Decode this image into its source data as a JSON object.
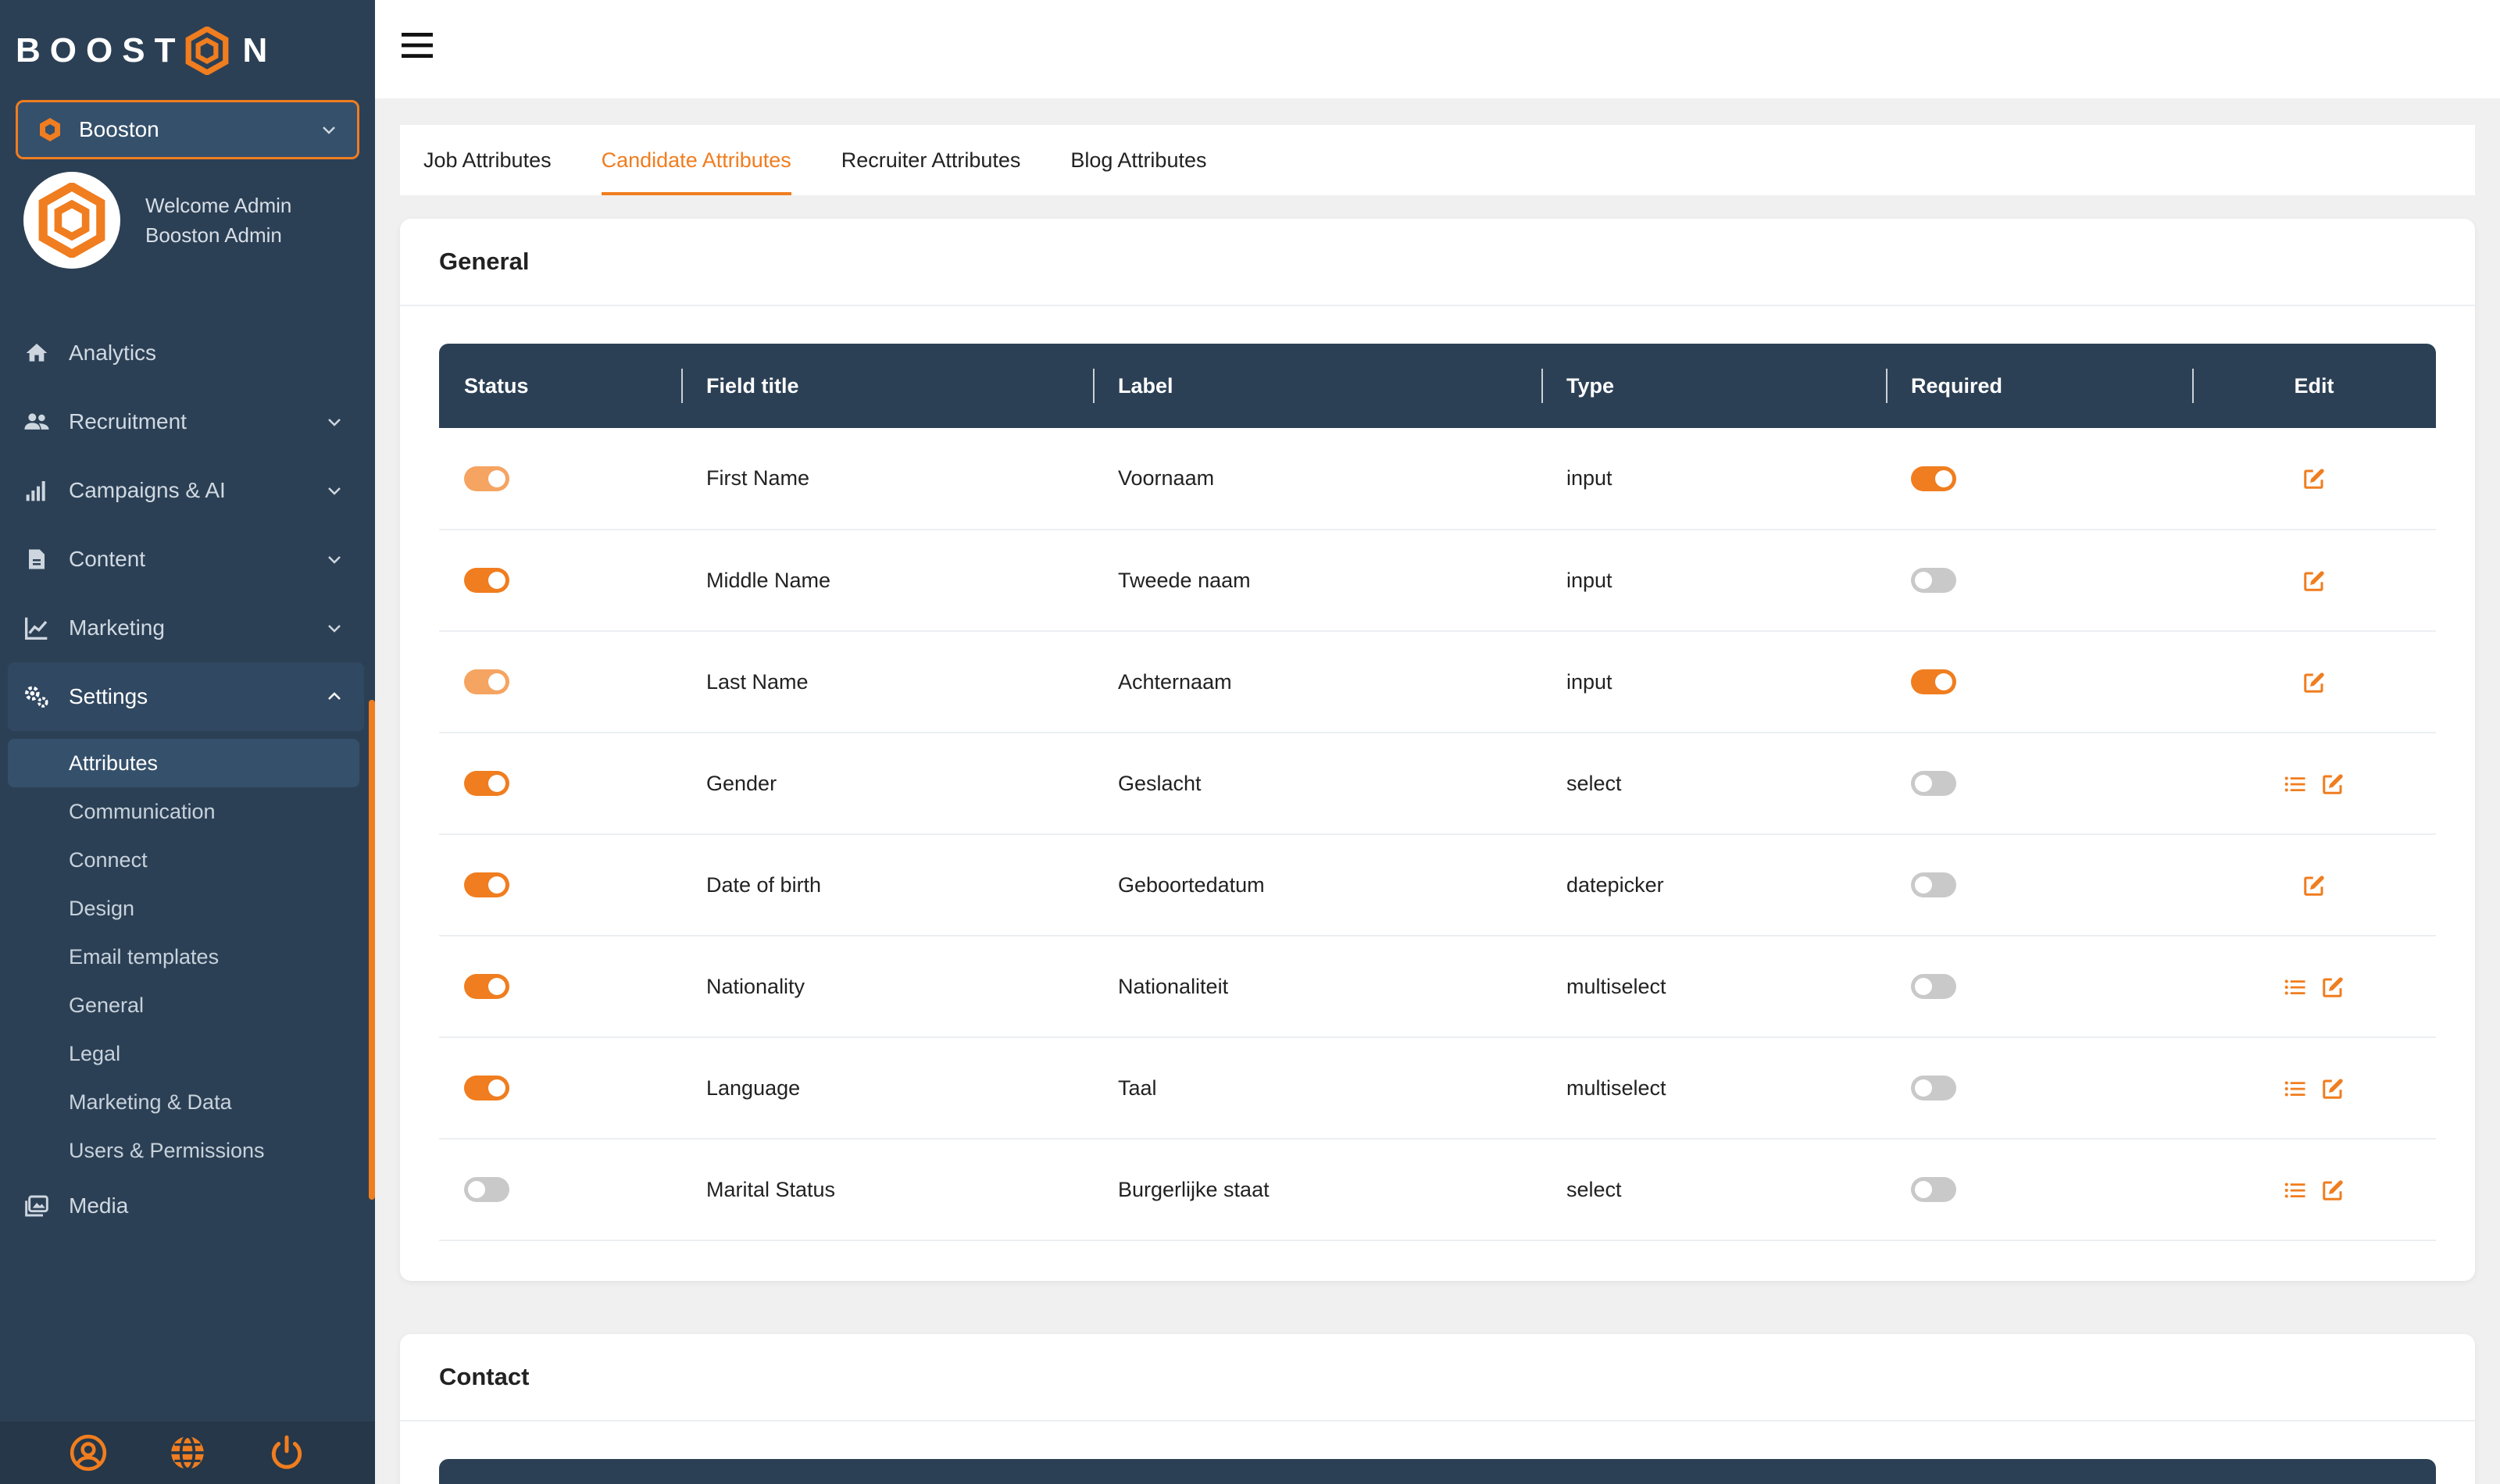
{
  "app": {
    "logo_text_left": "BOOST",
    "logo_text_right": "N",
    "accent_color": "#f07d1f",
    "sidebar_color": "#2c4055"
  },
  "org_select": {
    "value": "Booston"
  },
  "profile": {
    "welcome": "Welcome Admin",
    "name": "Booston Admin"
  },
  "nav": {
    "analytics": "Analytics",
    "recruitment": "Recruitment",
    "campaigns": "Campaigns & AI",
    "content": "Content",
    "marketing": "Marketing",
    "settings": "Settings",
    "media": "Media",
    "settings_items": [
      "Attributes",
      "Communication",
      "Connect",
      "Design",
      "Email templates",
      "General",
      "Legal",
      "Marketing & Data",
      "Users & Permissions"
    ]
  },
  "tabs": [
    "Job Attributes",
    "Candidate Attributes",
    "Recruiter Attributes",
    "Blog Attributes"
  ],
  "general": {
    "title": "General",
    "headers": [
      "Status",
      "Field title",
      "Label",
      "Type",
      "Required",
      "Edit"
    ],
    "rows": [
      {
        "field": "First Name",
        "label": "Voornaam",
        "type": "input",
        "status": "on-dim",
        "required": "on",
        "options": false
      },
      {
        "field": "Middle Name",
        "label": "Tweede naam",
        "type": "input",
        "status": "on",
        "required": "off",
        "options": false
      },
      {
        "field": "Last Name",
        "label": "Achternaam",
        "type": "input",
        "status": "on-dim",
        "required": "on",
        "options": false
      },
      {
        "field": "Gender",
        "label": "Geslacht",
        "type": "select",
        "status": "on",
        "required": "off",
        "options": true
      },
      {
        "field": "Date of birth",
        "label": "Geboortedatum",
        "type": "datepicker",
        "status": "on",
        "required": "off",
        "options": false
      },
      {
        "field": "Nationality",
        "label": "Nationaliteit",
        "type": "multiselect",
        "status": "on",
        "required": "off",
        "options": true
      },
      {
        "field": "Language",
        "label": "Taal",
        "type": "multiselect",
        "status": "on",
        "required": "off",
        "options": true
      },
      {
        "field": "Marital Status",
        "label": "Burgerlijke staat",
        "type": "select",
        "status": "off",
        "required": "off",
        "options": true
      }
    ]
  },
  "contact": {
    "title": "Contact"
  }
}
